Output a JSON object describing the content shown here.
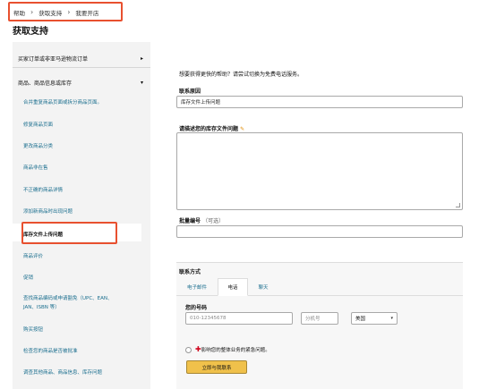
{
  "breadcrumb": {
    "items": [
      "帮助",
      "获取支持",
      "我要开店"
    ],
    "separator": "›"
  },
  "page": {
    "title": "获取支持"
  },
  "sidebar": {
    "group1": {
      "label": "买家订单或非亚马逊物流订单",
      "caret": "▸"
    },
    "group2": {
      "label": "商品、商品信息或库存",
      "caret": "▾"
    },
    "items": [
      {
        "label": "合并重复商品页面或拆分商品页面。"
      },
      {
        "label": "修复商品页面"
      },
      {
        "label": "更改商品分类"
      },
      {
        "label": "商品非在售"
      },
      {
        "label": "不正确的商品详情"
      },
      {
        "label": "添加新商品时出现问题"
      },
      {
        "label": "库存文件上传问题"
      },
      {
        "label": "商品评价"
      },
      {
        "label": "促销"
      },
      {
        "label": "查找商品编码或申请豁免（UPC、EAN、"
      },
      {
        "label": "JAN、ISBN 等）"
      },
      {
        "label": "购买按钮"
      },
      {
        "label": "检查您的商品是否被批准"
      },
      {
        "label": "调查其他商品、商品信息、库存问题"
      }
    ]
  },
  "form": {
    "intro": "想要获得更快的帮助？请尝试切换为免费电话服务。",
    "reason_label": "联系原因",
    "reason_value": "库存文件上传问题",
    "describe_label": "请描述您的库存文件问题",
    "batch_label": "批量编号",
    "batch_optional": "（可选）"
  },
  "contact": {
    "label": "联系方式",
    "tabs": [
      "电子邮件",
      "电话",
      "聊天"
    ],
    "number_label": "您的号码",
    "phone_placeholder": "010-12345678",
    "extension_placeholder": "分机号",
    "country_value": "美国",
    "select_arrow": "▾",
    "urgent_text": "影响您的整体业务的紧急问题。",
    "call_button": "立即与我联系"
  },
  "colors": {
    "highlight": "#e8502f",
    "link": "#1a6e8e",
    "button": "#f0c14b"
  },
  "icons": {
    "pencil": "✎",
    "plus": "✚"
  }
}
